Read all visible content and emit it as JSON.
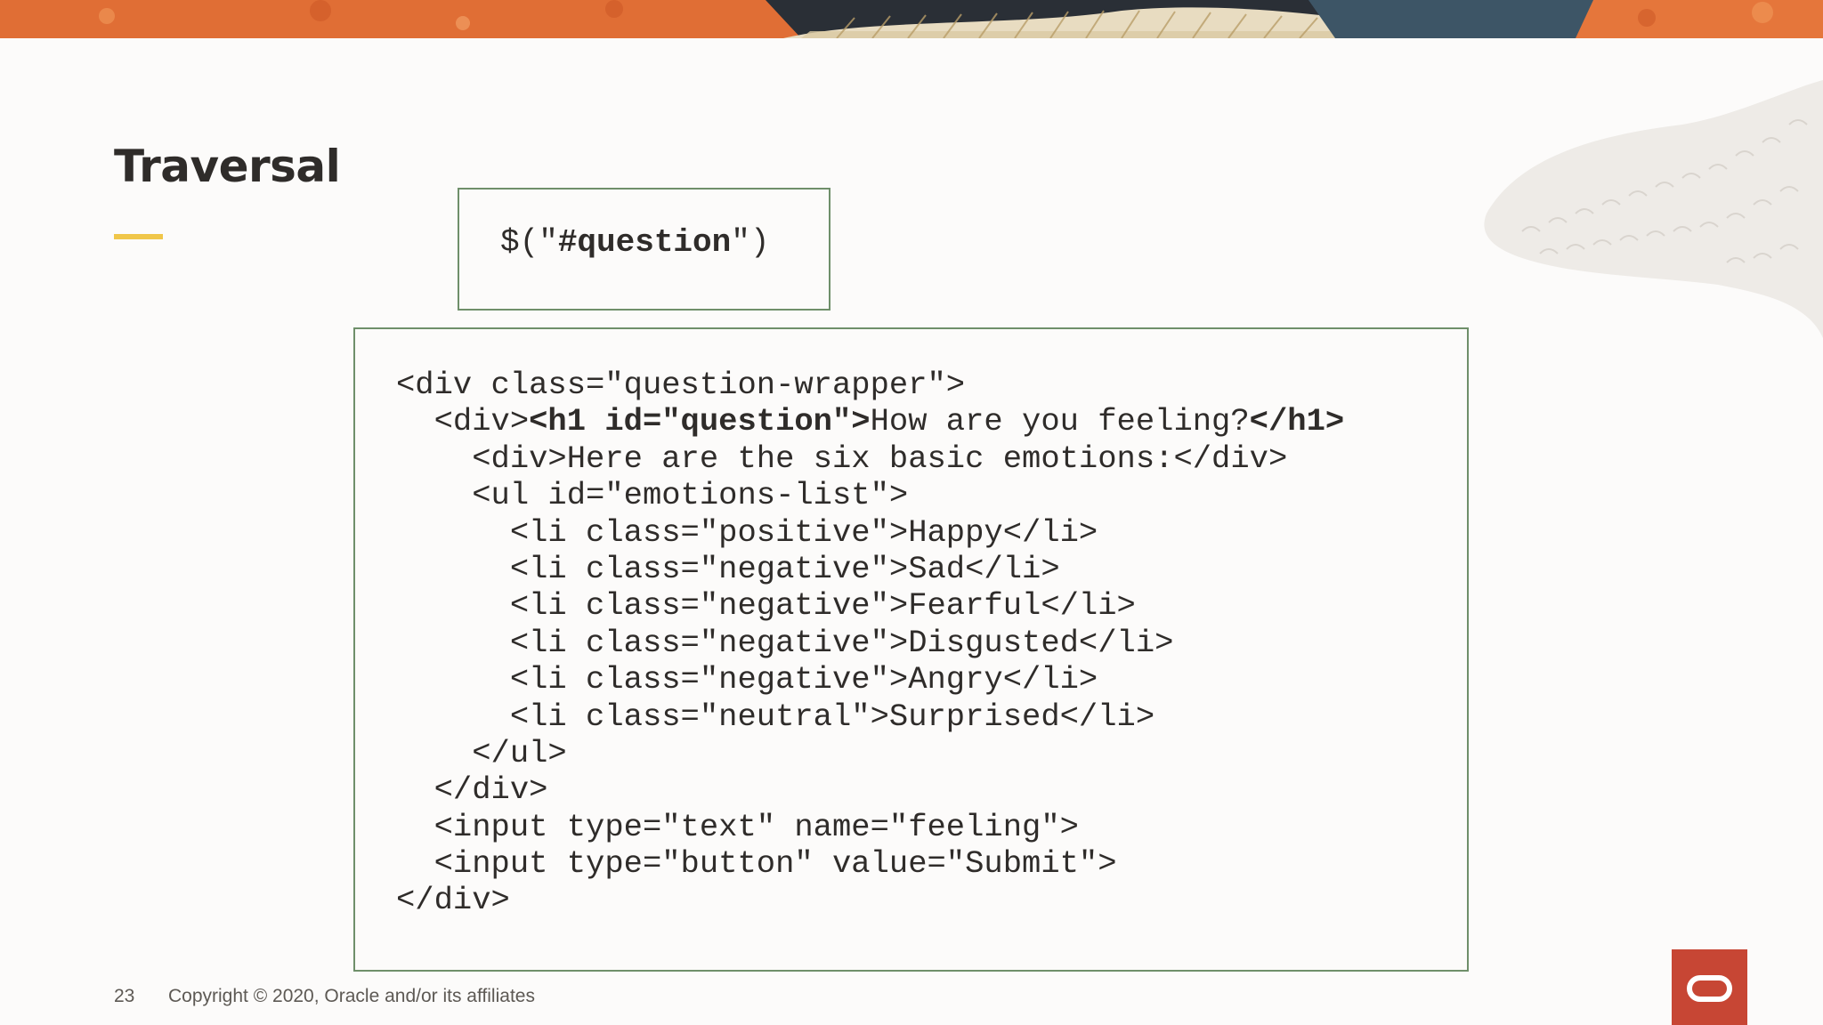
{
  "slide": {
    "title": "Traversal",
    "number": "23",
    "copyright": "Copyright © 2020, Oracle and/or its affiliates"
  },
  "selector": {
    "prefix": "$(\"",
    "emphasis": "#question",
    "suffix": "\")"
  },
  "code": {
    "lines": [
      [
        {
          "t": "<div class=\"question-wrapper\">",
          "b": false
        }
      ],
      [
        {
          "t": "  <div>",
          "b": false
        },
        {
          "t": "<h1 id=\"question\">",
          "b": true
        },
        {
          "t": "How are you feeling?",
          "b": false
        },
        {
          "t": "</h1>",
          "b": true
        }
      ],
      [
        {
          "t": "    <div>Here are the six basic emotions:</div>",
          "b": false
        }
      ],
      [
        {
          "t": "    <ul id=\"emotions-list\">",
          "b": false
        }
      ],
      [
        {
          "t": "      <li class=\"positive\">Happy</li>",
          "b": false
        }
      ],
      [
        {
          "t": "      <li class=\"negative\">Sad</li>",
          "b": false
        }
      ],
      [
        {
          "t": "      <li class=\"negative\">Fearful</li>",
          "b": false
        }
      ],
      [
        {
          "t": "      <li class=\"negative\">Disgusted</li>",
          "b": false
        }
      ],
      [
        {
          "t": "      <li class=\"negative\">Angry</li>",
          "b": false
        }
      ],
      [
        {
          "t": "      <li class=\"neutral\">Surprised</li>",
          "b": false
        }
      ],
      [
        {
          "t": "    </ul>",
          "b": false
        }
      ],
      [
        {
          "t": "  </div>",
          "b": false
        }
      ],
      [
        {
          "t": "  <input type=\"text\" name=\"feeling\">",
          "b": false
        }
      ],
      [
        {
          "t": "  <input type=\"button\" value=\"Submit\">",
          "b": false
        }
      ],
      [
        {
          "t": "</div>",
          "b": false
        }
      ]
    ]
  },
  "colors": {
    "accent": "#f0c649",
    "box_border": "#6f8f6a",
    "oracle_red": "#c74634",
    "text": "#2f2c2a"
  },
  "icons": {
    "logo": "oracle-logo-icon"
  }
}
